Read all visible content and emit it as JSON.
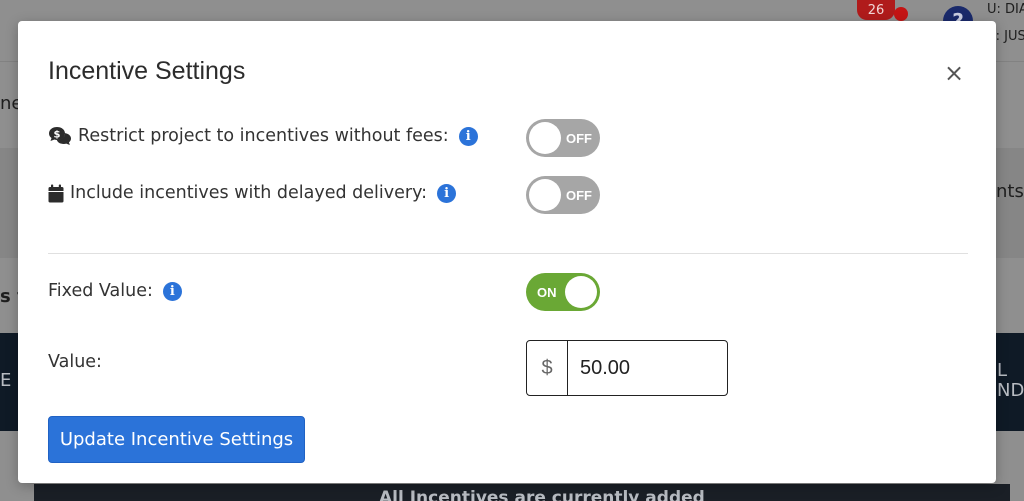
{
  "background": {
    "notification_count": "26",
    "user_line1": "U: DIA",
    "user_line2": "A: JUS",
    "help_glyph": "?",
    "left_fragment_1": "ne",
    "left_fragment_2": "s fi",
    "left_fragment_3": "E",
    "right_fragment_1": "nts",
    "right_fragment_2": "L",
    "right_fragment_3": "ND",
    "bottom_text": "All Incentives are currently added"
  },
  "modal": {
    "title": "Incentive Settings",
    "close_glyph": "×",
    "restrict_fees": {
      "icon": "money-chat-icon",
      "label": "Restrict project to incentives without fees:",
      "toggle_state": "OFF"
    },
    "delayed_delivery": {
      "icon": "calendar-icon",
      "label": "Include incentives with delayed delivery:",
      "toggle_state": "OFF"
    },
    "fixed_value": {
      "label": "Fixed Value:",
      "toggle_state": "ON"
    },
    "value": {
      "label": "Value:",
      "currency_symbol": "$",
      "amount": "50.00"
    },
    "info_glyph": "i",
    "update_button_label": "Update Incentive Settings"
  },
  "colors": {
    "primary_blue": "#2b73d9",
    "toggle_on": "#6aa835",
    "toggle_off": "#a6a6a6",
    "badge_red": "#b01b1b"
  }
}
